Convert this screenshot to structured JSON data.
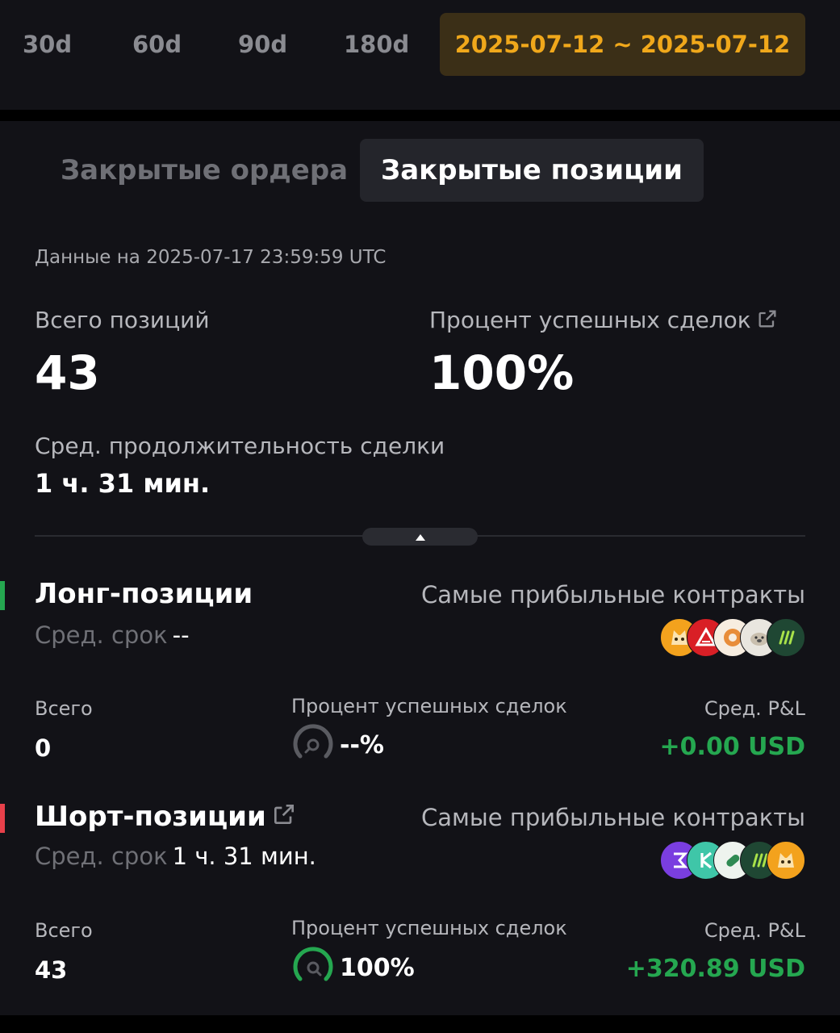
{
  "period": {
    "tabs": [
      "30d",
      "60d",
      "90d",
      "180d"
    ],
    "selected_range": "2025-07-12 ~ 2025-07-12"
  },
  "segment": {
    "inactive_label": "Закрытые ордера",
    "active_label": "Закрытые позиции"
  },
  "as_of": "Данные на 2025-07-17 23:59:59 UTC",
  "summary": {
    "total_positions_label": "Всего позиций",
    "total_positions_value": "43",
    "win_rate_label": "Процент успешных сделок",
    "win_rate_value": "100%",
    "avg_duration_label": "Сред. продолжительность сделки",
    "avg_duration_value": "1 ч. 31 мин."
  },
  "long": {
    "title": "Лонг-позиции",
    "term_label": "Сред. срок",
    "term_value": "--",
    "profitable_label": "Самые прибыльные контракты",
    "coins": [
      "shib-coin-icon",
      "arb-red-coin-icon",
      "donut-coin-icon",
      "otter-coin-icon",
      "sei-green-coin-icon"
    ],
    "total_label": "Всего",
    "total_value": "0",
    "win_rate_label": "Процент успешных сделок",
    "win_rate_value": "--%",
    "win_rate_fraction": 0,
    "pnl_label": "Сред. P&L",
    "pnl_value": "+0.00 USD",
    "pnl_color": "#25a750"
  },
  "short": {
    "title": "Шорт-позиции",
    "term_label": "Сред. срок",
    "term_value": "1 ч. 31 мин.",
    "profitable_label": "Самые прибыльные контракты",
    "coins": [
      "purple-x-coin-icon",
      "k-teal-coin-icon",
      "capsule-coin-icon",
      "sei-green-coin-icon",
      "shib-coin-icon"
    ],
    "total_label": "Всего",
    "total_value": "43",
    "win_rate_label": "Процент успешных сделок",
    "win_rate_value": "100%",
    "win_rate_fraction": 1,
    "pnl_label": "Сред. P&L",
    "pnl_value": "+320.89 USD",
    "pnl_color": "#25a750"
  },
  "colors": {
    "accent": "#f0a81b",
    "long_marker": "#25a750",
    "short_marker": "#e8404a",
    "gauge_green": "#25a750",
    "gauge_gray": "#5a5b61"
  }
}
